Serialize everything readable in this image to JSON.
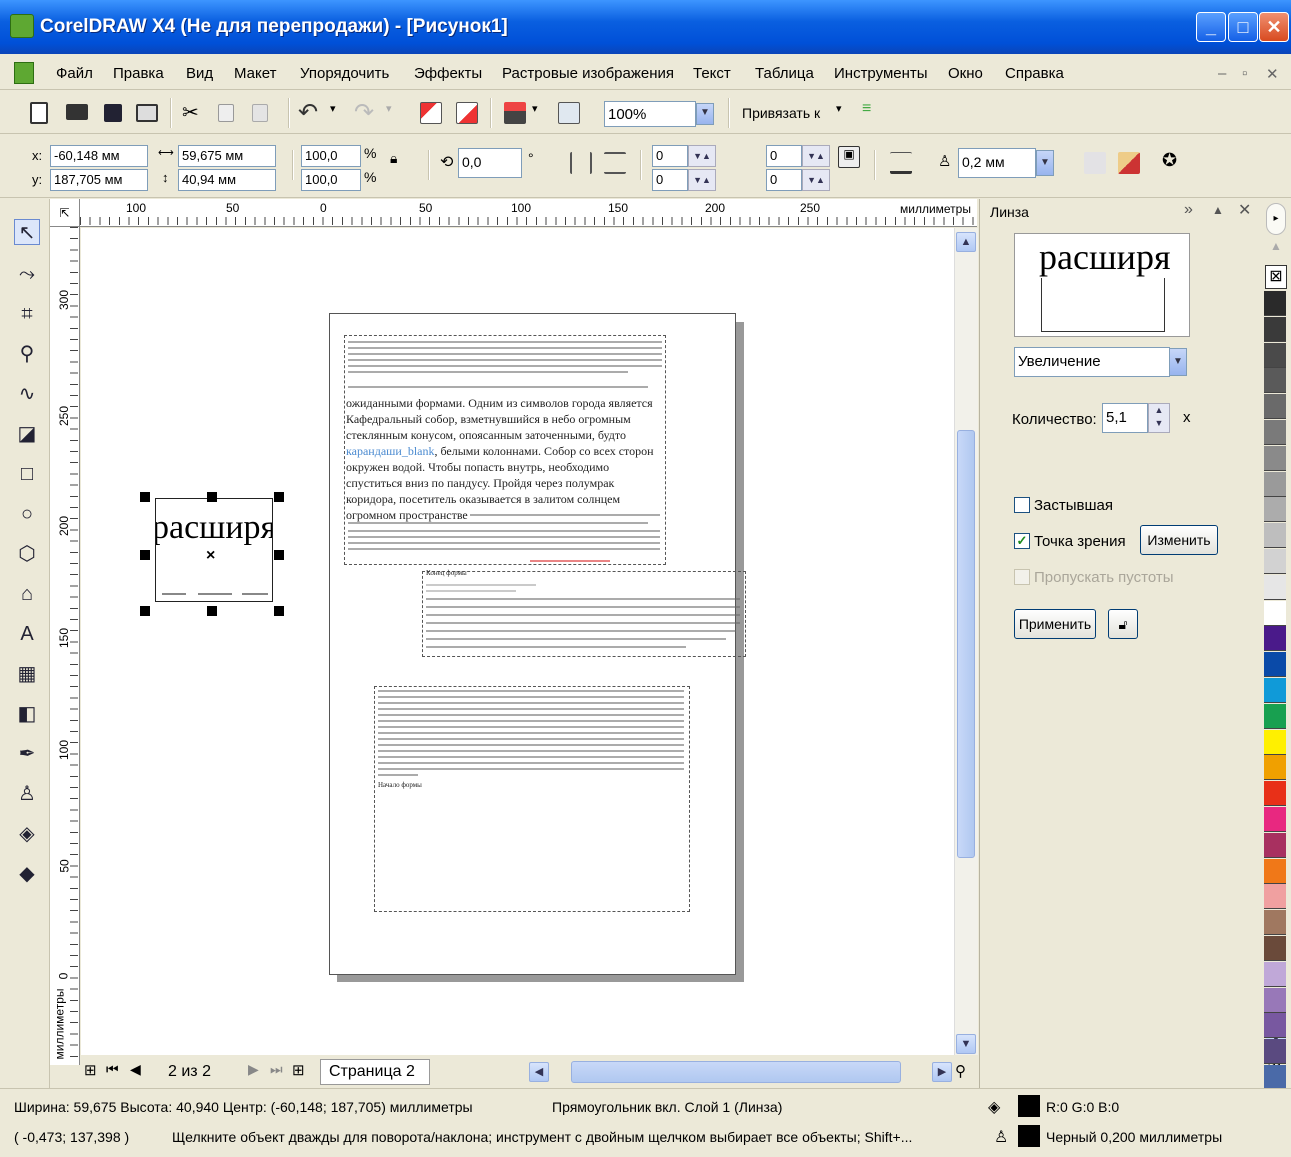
{
  "window": {
    "title": "CorelDRAW X4 (Не для перепродажи) - [Рисунок1]",
    "min": "_",
    "max": "□",
    "close": "✕"
  },
  "menu": [
    "Файл",
    "Правка",
    "Вид",
    "Макет",
    "Упорядочить",
    "Эффекты",
    "Растровые изображения",
    "Текст",
    "Таблица",
    "Инструменты",
    "Окно",
    "Справка"
  ],
  "menu_right": {
    "min": "–",
    "restore": "▫",
    "close": "✕"
  },
  "standard": {
    "zoom": "100%",
    "snap_label": "Привязать к"
  },
  "property": {
    "x_label": "x:",
    "x_value": "-60,148 мм",
    "y_label": "y:",
    "y_value": "187,705 мм",
    "w_value": "59,675 мм",
    "h_value": "40,94 мм",
    "sx_value": "100,0",
    "sy_value": "100,0",
    "pct": "%",
    "pct2": "%",
    "rot_value": "0,0",
    "deg": "°",
    "c1": "0",
    "c2": "0",
    "c3": "0",
    "c4": "0",
    "outline_value": "0,2 мм"
  },
  "ruler": {
    "units": "миллиметры",
    "v_units": "миллиметры",
    "h_ticks": [
      "100",
      "50",
      "0",
      "50",
      "100",
      "150",
      "200",
      "250"
    ],
    "v_ticks": [
      "300",
      "250",
      "200",
      "150",
      "100",
      "50",
      "0"
    ]
  },
  "selection": {
    "lens_text": "расширя"
  },
  "page_text": {
    "l1": "ожиданными формами. Одним из символов города является",
    "l2": "Кафедральный собор, взметнувшийся в небо огромным",
    "l3": "стеклянным конусом, опоясанным заточенными, будто",
    "l4a": "карандаши_blank",
    "l4b": ", белыми колоннами. Собор со всех сторон",
    "l5": "окружен водой. Чтобы попасть внутрь, необходимо",
    "l6": "спуститься вниз по пандусу. Пройдя через полумрак",
    "l7": "коридора, посетитель оказывается в залитом солнцем",
    "l8": "огромном пространстве",
    "f2a": "Конец формы",
    "f3end": "Начало формы"
  },
  "pages": {
    "counter": "2 из 2",
    "tab": "Страница 2"
  },
  "docker": {
    "title": "Линза",
    "preview_text": "расширя",
    "mode": "Увеличение",
    "amount_label": "Количество:",
    "amount_value": "5,1",
    "amount_unit": "x",
    "frozen_label": "Застывшая",
    "frozen_checked": false,
    "viewpoint_label": "Точка зрения",
    "viewpoint_checked": true,
    "edit_button": "Изменить",
    "remove_face_label": "Пропускать пустоты",
    "apply_button": "Применить"
  },
  "palette": [
    "#2a2a2a",
    "#3a3a3a",
    "#4a4a4a",
    "#5a5a5a",
    "#6a6a6a",
    "#7a7a7a",
    "#8a8a8a",
    "#9a9a9a",
    "#acacac",
    "#bebebe",
    "#d2d2d2",
    "#e6e6e6",
    "#ffffff",
    "#4a1a8a",
    "#0a4aa8",
    "#109ad8",
    "#18a050",
    "#fff000",
    "#f0a000",
    "#e83018",
    "#e82880",
    "#a83060",
    "#f07818",
    "#f0a0a0",
    "#a07860",
    "#6a4a3a",
    "#c0a8d8",
    "#9878b8",
    "#7858a0",
    "#5a4a80",
    "#4a6aa8",
    "#3a3a6a"
  ],
  "status": {
    "line1": "Ширина: 59,675 Высота: 40,940 Центр: (-60,148; 187,705)  миллиметры",
    "object": "Прямоугольник вкл. Слой 1  (Линза)",
    "fill": "R:0 G:0 B:0",
    "coords": "( -0,473; 137,398 )",
    "hint": "Щелкните объект дважды для поворота/наклона; инструмент с двойным щелчком выбирает все объекты; Shift+...",
    "outline": "Черный  0,200 миллиметры"
  }
}
